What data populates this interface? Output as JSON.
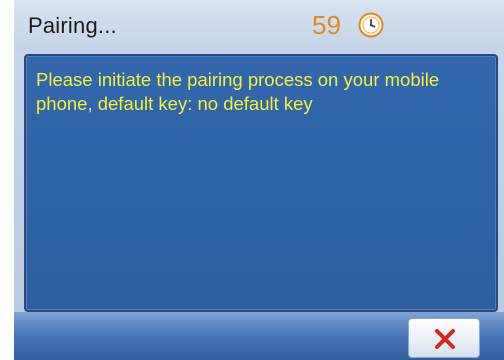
{
  "header": {
    "title": "Pairing...",
    "countdown": "59",
    "timer_icon": "clock-icon"
  },
  "dialog": {
    "message": "Please initiate the pairing process on your mobile phone, default key: no default key"
  },
  "footer": {
    "cancel_icon": "close-icon"
  },
  "colors": {
    "countdown": "#e08a1e",
    "message": "#f3f234",
    "panel": "#2f63a8",
    "cancel_x": "#d5271f"
  }
}
